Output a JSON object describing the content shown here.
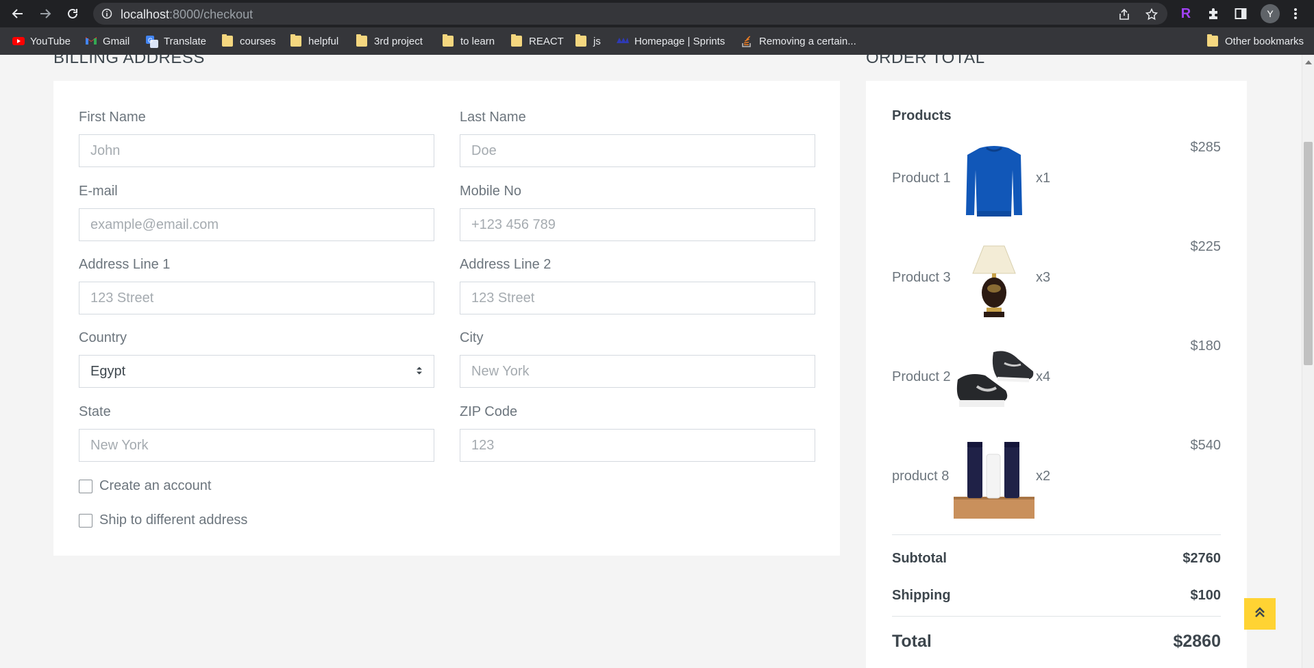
{
  "browser": {
    "url_host": "localhost",
    "url_path": ":8000/checkout",
    "profile_initial": "Y",
    "bookmarks": [
      {
        "label": "YouTube",
        "icon": "youtube-icon"
      },
      {
        "label": "Gmail",
        "icon": "gmail-icon"
      },
      {
        "label": "Translate",
        "icon": "translate-icon"
      },
      {
        "label": "courses",
        "icon": "folder-icon"
      },
      {
        "label": "helpful",
        "icon": "folder-icon"
      },
      {
        "label": "3rd project",
        "icon": "folder-icon"
      },
      {
        "label": "to learn",
        "icon": "folder-icon"
      },
      {
        "label": "REACT",
        "icon": "folder-icon"
      },
      {
        "label": "js",
        "icon": "folder-icon"
      },
      {
        "label": "Homepage | Sprints",
        "icon": "sprints-icon"
      },
      {
        "label": "Removing a certain...",
        "icon": "stackoverflow-icon"
      }
    ],
    "other_bookmarks": "Other bookmarks"
  },
  "billing": {
    "title": "Billing Address",
    "first_name": {
      "label": "First Name",
      "placeholder": "John"
    },
    "last_name": {
      "label": "Last Name",
      "placeholder": "Doe"
    },
    "email": {
      "label": "E-mail",
      "placeholder": "example@email.com"
    },
    "mobile": {
      "label": "Mobile No",
      "placeholder": "+123 456 789"
    },
    "address1": {
      "label": "Address Line 1",
      "placeholder": "123 Street"
    },
    "address2": {
      "label": "Address Line 2",
      "placeholder": "123 Street"
    },
    "country": {
      "label": "Country",
      "value": "Egypt"
    },
    "city": {
      "label": "City",
      "placeholder": "New York"
    },
    "state": {
      "label": "State",
      "placeholder": "New York"
    },
    "zip": {
      "label": "ZIP Code",
      "placeholder": "123"
    },
    "create_account": "Create an account",
    "ship_different": "Ship to different address"
  },
  "order": {
    "title": "Order Total",
    "products_heading": "Products",
    "items": [
      {
        "name": "Product 1",
        "qty": "x1",
        "price": "$285",
        "image": "blue-sweater"
      },
      {
        "name": "Product 3",
        "qty": "x3",
        "price": "$225",
        "image": "table-lamp"
      },
      {
        "name": "Product 2",
        "qty": "x4",
        "price": "$180",
        "image": "sneakers"
      },
      {
        "name": "product 8",
        "qty": "x2",
        "price": "$540",
        "image": "cosmetics"
      }
    ],
    "subtotal_label": "Subtotal",
    "subtotal_value": "$2760",
    "shipping_label": "Shipping",
    "shipping_value": "$100",
    "total_label": "Total",
    "total_value": "$2860"
  },
  "colors": {
    "accent": "#ffd333",
    "chrome_dark": "#202124",
    "bookmark_bar": "#35363a",
    "page_bg": "#f4f4f4"
  }
}
